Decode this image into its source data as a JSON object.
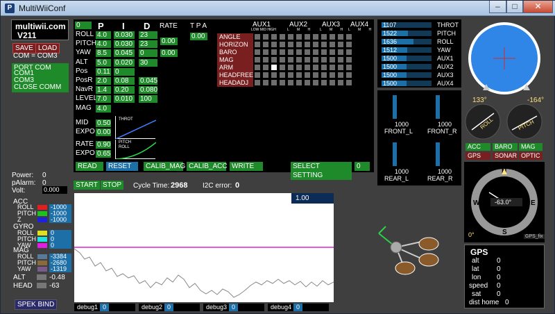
{
  "window": {
    "title": "MultiWiiConf"
  },
  "version": {
    "name": "multiwii.com",
    "num": "V211"
  },
  "config": {
    "save": "SAVE",
    "load": "LOAD",
    "com": "COM = COM3"
  },
  "port": {
    "title": "PORT COM",
    "items": [
      "COM1",
      "COM3"
    ],
    "close": "CLOSE COMM"
  },
  "pid": {
    "cycle_badge": "0",
    "headers": {
      "p": "P",
      "i": "I",
      "d": "D",
      "rate": "RATE",
      "tpa": "T P A"
    },
    "rows": [
      {
        "name": "ROLL",
        "p": "4.0",
        "i": "0.030",
        "d": "23"
      },
      {
        "name": "PITCH",
        "p": "4.0",
        "i": "0.030",
        "d": "23"
      },
      {
        "name": "YAW",
        "p": "8.5",
        "i": "0.045",
        "d": "0"
      },
      {
        "name": "ALT",
        "p": "5.0",
        "i": "0.020",
        "d": "30"
      },
      {
        "name": "Pos",
        "p": "0.11",
        "i": "0",
        "d": ""
      },
      {
        "name": "PosR",
        "p": "2.0",
        "i": "0.08",
        "d": "0.045"
      },
      {
        "name": "NavR",
        "p": "1.4",
        "i": "0.20",
        "d": "0.080"
      },
      {
        "name": "LEVEL",
        "p": "7.0",
        "i": "0.010",
        "d": "100"
      },
      {
        "name": "MAG",
        "p": "4.0",
        "i": "",
        "d": ""
      }
    ],
    "rate_rollpitch": "0.00",
    "rate_yaw": "0.00",
    "tpa": "0.00",
    "mid_label": "MID",
    "mid": "0.50",
    "expo_label": "EXPO",
    "expo": "0.00",
    "rate_label": "RATE",
    "rate": "0.90",
    "expo2_label": "EXPO",
    "expo2": "0.65",
    "throt_curve_label": "THROT",
    "pitchroll_curve_label": "PITCH\nROLL"
  },
  "aux": {
    "headers": [
      "AUX1",
      "AUX2",
      "AUX3",
      "AUX4"
    ],
    "sub": "LOW MID HIGH",
    "sub_short": "L M H",
    "modes": [
      "ANGLE",
      "HORIZON",
      "BARO",
      "MAG",
      "ARM",
      "HEADFREE",
      "HEADADJ"
    ],
    "active_cell": {
      "mode": "ARM",
      "col": 2
    }
  },
  "buttons": {
    "read": "READ",
    "reset": "RESET",
    "calib_mag": "CALIB_MAG",
    "calib_acc": "CALIB_ACC",
    "write": "WRITE",
    "select_setting": "SELECT SETTING",
    "setting_value": "0"
  },
  "rc": [
    {
      "value": 1107,
      "name": "THROT"
    },
    {
      "value": 1522,
      "name": "PITCH"
    },
    {
      "value": 1636,
      "name": "ROLL"
    },
    {
      "value": 1512,
      "name": "YAW"
    },
    {
      "value": 1500,
      "name": "AUX1"
    },
    {
      "value": 1500,
      "name": "AUX2"
    },
    {
      "value": 1500,
      "name": "AUX3"
    },
    {
      "value": 1500,
      "name": "AUX4"
    }
  ],
  "motors": [
    {
      "name": "FRONT_L",
      "value": "1000"
    },
    {
      "name": "FRONT_R",
      "value": "1000"
    },
    {
      "name": "REAR_L",
      "value": "1000"
    },
    {
      "name": "REAR_R",
      "value": "1000"
    }
  ],
  "status": {
    "power_label": "Power:",
    "power": "0",
    "palarm_label": "pAlarm:",
    "palarm": "0",
    "volt_label": "Volt:",
    "volt": "0.000"
  },
  "graph": {
    "start": "START",
    "stop": "STOP",
    "cycle_label": "Cycle Time:",
    "cycle": "2968",
    "i2c_label": "I2C error:",
    "i2c": "0",
    "scale": "1.00"
  },
  "sensors": {
    "acc": {
      "title": "ACC",
      "roll": "-1000",
      "pitch": "-1000",
      "z": "-1000"
    },
    "gyro": {
      "title": "GYRO",
      "roll": "0",
      "pitch": "0",
      "yaw": "0"
    },
    "mag": {
      "title": "MAG",
      "roll": "-3384",
      "pitch": "-2680",
      "yaw": "-1319"
    },
    "alt_label": "ALT",
    "alt": "-0.48",
    "head_label": "HEAD",
    "head": "-63",
    "labels": {
      "roll": "ROLL",
      "pitch": "PITCH",
      "yaw": "YAW",
      "z": "Z"
    }
  },
  "spek": "SPEK BIND",
  "debug": [
    {
      "label": "debug1",
      "value": "0"
    },
    {
      "label": "debug2",
      "value": "0"
    },
    {
      "label": "debug3",
      "value": "0"
    },
    {
      "label": "debug4",
      "value": "0"
    }
  ],
  "attitude": {
    "roll_deg": "133°",
    "pitch_deg": "-164°",
    "roll_label": "ROLL",
    "pitch_label": "PITCH"
  },
  "indicators": {
    "acc": "ACC",
    "baro": "BARO",
    "mag": "MAG",
    "gps": "GPS",
    "sonar": "SONAR",
    "optic": "OPTIC"
  },
  "compass": {
    "n": "N",
    "e": "E",
    "s": "S",
    "w": "W",
    "heading": "-63.0°",
    "zero": "0°",
    "gps_fix": "GPS_fix"
  },
  "gps": {
    "title": "GPS",
    "alt_label": "alt",
    "alt": "0",
    "lat_label": "lat",
    "lat": "0",
    "lon_label": "lon",
    "lon": "0",
    "speed_label": "speed",
    "speed": "0",
    "sat_label": "sat",
    "sat": "0",
    "dist_label": "dist home",
    "dist": "0"
  },
  "colors": {
    "green": "#1f8a2a",
    "red": "#7a1f1f",
    "blue": "#1d6fa8",
    "sky": "#2f86e6",
    "magenta": "#e020e0"
  }
}
